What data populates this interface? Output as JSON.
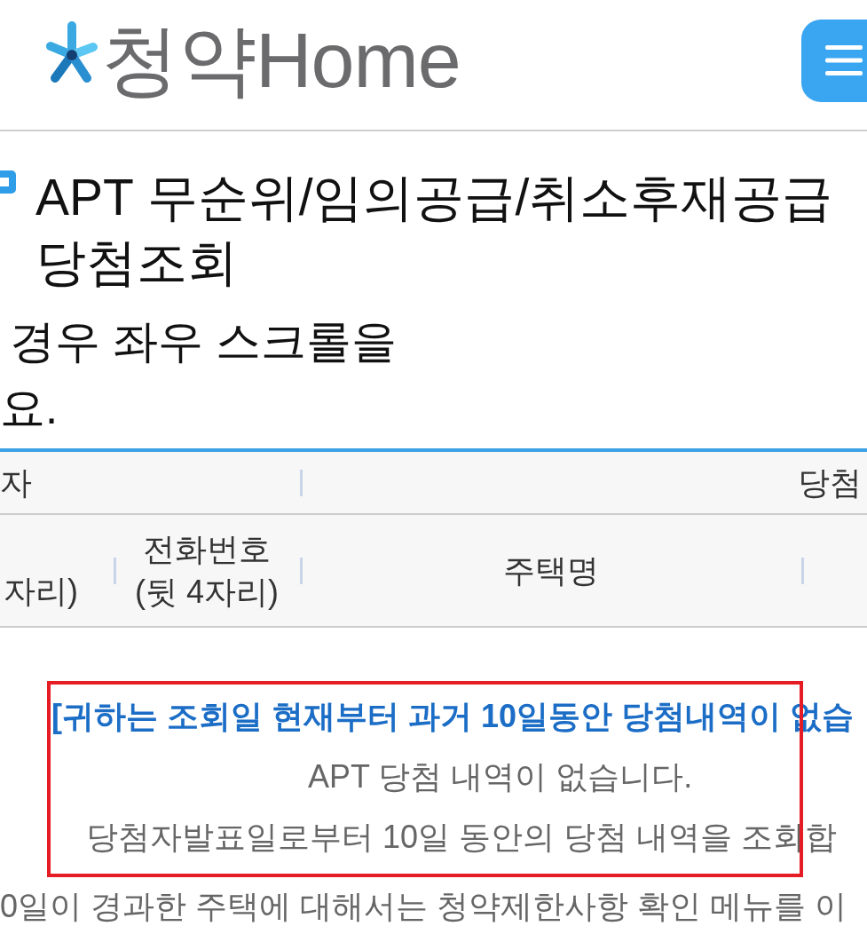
{
  "header": {
    "logo_text": "청약Home"
  },
  "page_title": "APT 무순위/임의공급/취소후재공급 당첨조회",
  "notice_lines": [
    "경우 좌우 스크롤을",
    "요."
  ],
  "table": {
    "group_headers": [
      "자",
      "당첨"
    ],
    "columns": [
      "자리)",
      "전화번호 (뒷 4자리)",
      "주택명"
    ]
  },
  "results": {
    "highlighted": true,
    "message": "[귀하는 조회일 현재부터 과거 10일동안 당첨내역이 없습",
    "lines": [
      "APT 당첨 내역이 없습니다.",
      "당첨자발표일로부터 10일 동안의 당첨 내역을 조회합"
    ]
  },
  "footnote": "0일이 경과한 주택에 대해서는 청약제한사항 확인 메뉴를 이"
}
